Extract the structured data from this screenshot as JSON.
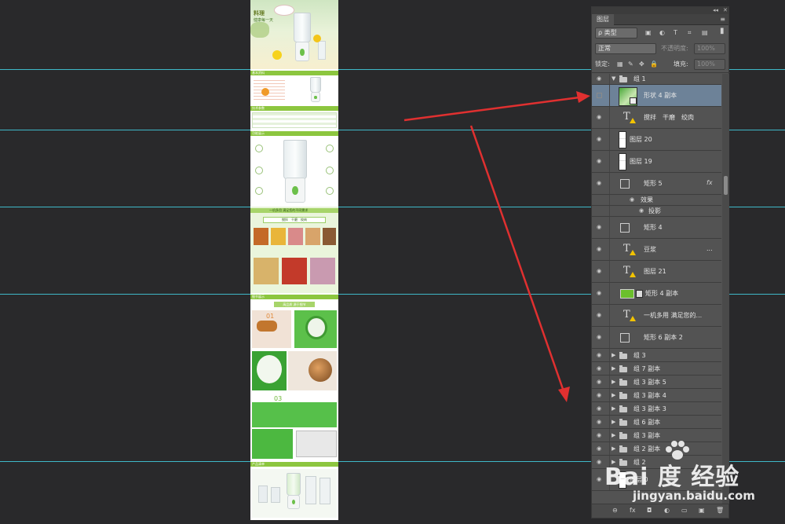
{
  "panel": {
    "title": "图层",
    "collapse_glyph": "◂◂",
    "close_glyph": "✕",
    "menu_glyph": "≡",
    "filter_label": "ρ 类型",
    "blend_mode": "正常",
    "opacity_label": "不透明度:",
    "opacity_value": "100%",
    "lock_label": "锁定:",
    "fill_label": "填充:",
    "fill_value": "100%"
  },
  "layers": [
    {
      "name": "组 1",
      "kind": "group-open"
    },
    {
      "name": "形状 4 副本",
      "kind": "shape-photo",
      "selected": true,
      "visible": false
    },
    {
      "name": "搅拌　干磨　绞肉",
      "kind": "text-warn"
    },
    {
      "name": "图层 20",
      "kind": "raster"
    },
    {
      "name": "图层 19",
      "kind": "raster"
    },
    {
      "name": "矩形 5",
      "kind": "shape",
      "fx": "fx"
    },
    {
      "name": "效果",
      "kind": "effect"
    },
    {
      "name": "投影",
      "kind": "effect-sub"
    },
    {
      "name": "矩形 4",
      "kind": "shape"
    },
    {
      "name": "豆浆",
      "kind": "text-warn",
      "trail": "..."
    },
    {
      "name": "图层 21",
      "kind": "text-warn"
    },
    {
      "name": "矩形 4 副本",
      "kind": "green-shape"
    },
    {
      "name": "一机多用 满足您的...",
      "kind": "text-warn"
    },
    {
      "name": "矩形 6 副本 2",
      "kind": "shape"
    },
    {
      "name": "组 3",
      "kind": "group"
    },
    {
      "name": "组 7 副本",
      "kind": "group"
    },
    {
      "name": "组 3 副本 5",
      "kind": "group"
    },
    {
      "name": "组 3 副本 4",
      "kind": "group"
    },
    {
      "name": "组 3 副本 3",
      "kind": "group"
    },
    {
      "name": "组 6 副本",
      "kind": "group"
    },
    {
      "name": "组 3 副本",
      "kind": "group"
    },
    {
      "name": "组 2 副本",
      "kind": "group"
    },
    {
      "name": "组 2",
      "kind": "group"
    },
    {
      "name": "图层 0",
      "kind": "raster"
    }
  ],
  "bottom_icons": [
    "⊖",
    "fx",
    "◘",
    "◐",
    "▭",
    "▣",
    "🗑"
  ],
  "canvas": {
    "hero_line1": "料理",
    "hero_line2": "健康每一天",
    "sec1": "基本资料",
    "sec2": "技术参数",
    "sec3": "功能展示",
    "sec4_title": "一机多用 满足您的不同需求",
    "sec4_sub": "搅拌　干磨　绞肉",
    "sec5": "细节展示",
    "sec5_sub": "高品质 源于细节",
    "sec5_num1": "01",
    "sec5_num3": "03",
    "sec6": "产品清单"
  },
  "watermark": {
    "brand": "Bai 度 经验",
    "url": "jingyan.baidu.com"
  },
  "colors": {
    "workspace": "#29292b",
    "guide": "#3fb8c8",
    "panel": "#535353",
    "selected_row": "#6d8298",
    "arrow": "#e03030",
    "accent_green": "#8cc63f"
  }
}
